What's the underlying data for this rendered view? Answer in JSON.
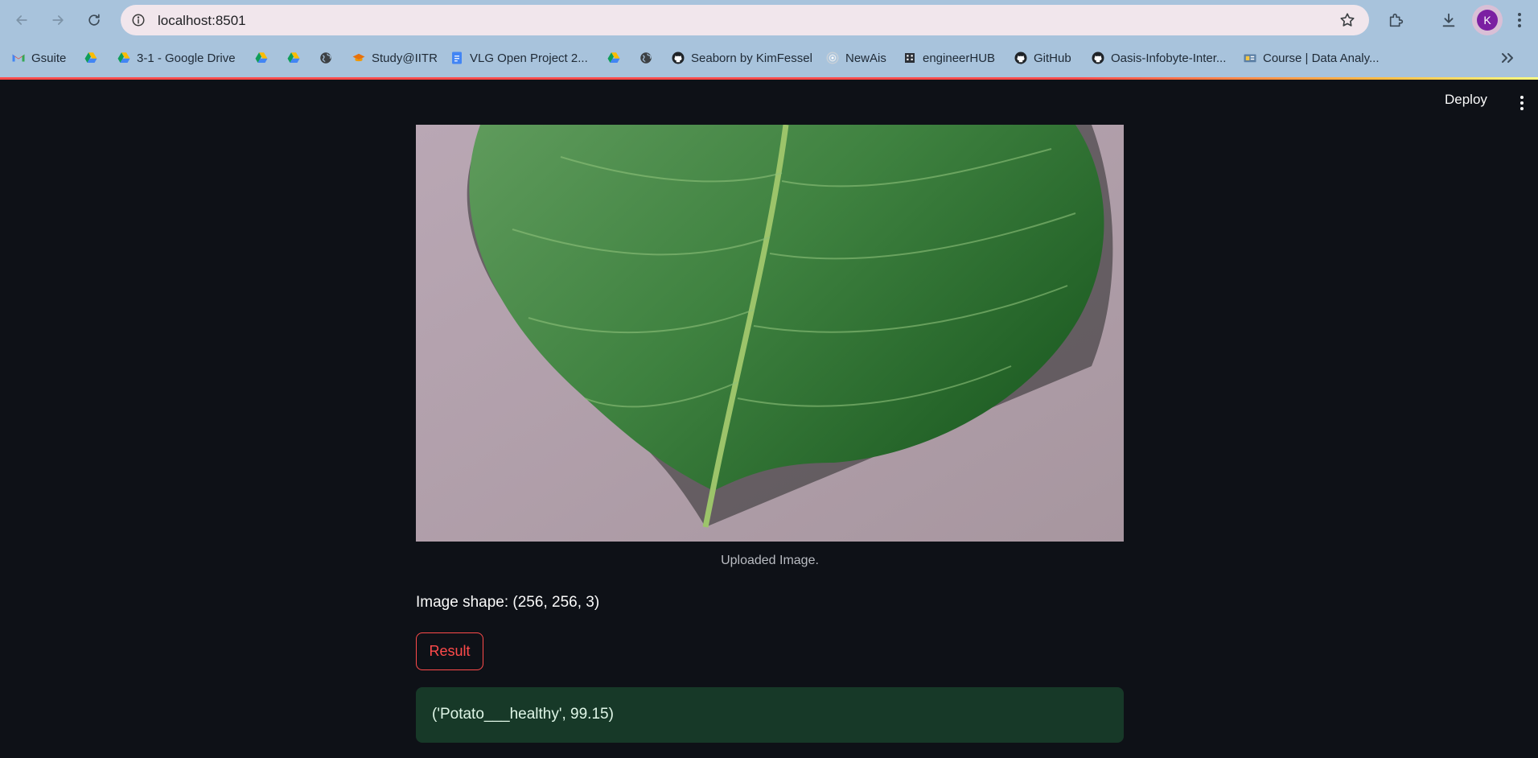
{
  "browser": {
    "url": "localhost:8501",
    "profile_initial": "K",
    "bookmarks": [
      {
        "label": "Gsuite",
        "icon": "gmail-icon"
      },
      {
        "label": "",
        "icon": "google-drive-icon"
      },
      {
        "label": "3-1 - Google Drive",
        "icon": "google-drive-icon"
      },
      {
        "label": "",
        "icon": "google-drive-icon"
      },
      {
        "label": "",
        "icon": "google-drive-icon"
      },
      {
        "label": "",
        "icon": "globe-icon"
      },
      {
        "label": "Study@IITR",
        "icon": "graduation-cap-icon"
      },
      {
        "label": "VLG Open Project 2...",
        "icon": "google-docs-icon"
      },
      {
        "label": "",
        "icon": "google-drive-icon"
      },
      {
        "label": "",
        "icon": "globe-icon"
      },
      {
        "label": "Seaborn by KimFessel",
        "icon": "github-icon"
      },
      {
        "label": "NewAis",
        "icon": "target-icon"
      },
      {
        "label": "engineerHUB",
        "icon": "building-icon"
      },
      {
        "label": "GitHub",
        "icon": "github-icon"
      },
      {
        "label": "Oasis-Infobyte-Inter...",
        "icon": "github-icon"
      },
      {
        "label": "Course | Data Analy...",
        "icon": "course-icon"
      }
    ]
  },
  "app": {
    "deploy_label": "Deploy",
    "image_caption": "Uploaded Image.",
    "image_shape_text": "Image shape: (256, 256, 3)",
    "result_button_label": "Result",
    "prediction_text": "('Potato___healthy', 99.15)"
  },
  "colors": {
    "app_background": "#0e1117",
    "accent": "#ff4b4b",
    "success_background": "#173928",
    "browser_frame": "#a8c3dc"
  }
}
